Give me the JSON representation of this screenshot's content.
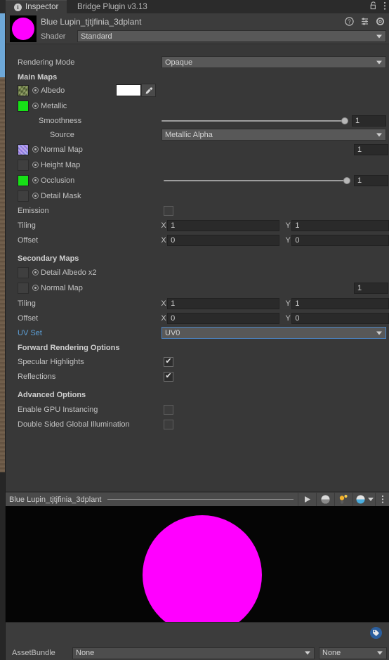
{
  "window": {
    "tabs": [
      {
        "label": "Inspector",
        "icon": "info-icon",
        "active": true
      },
      {
        "label": "Bridge Plugin v3.13",
        "active": false
      }
    ],
    "lock_icon": "lock-open-icon",
    "menu_icon": "kebab-menu-icon"
  },
  "material": {
    "name": "Blue Lupin_tjtjfinia_3dplant",
    "preview_color": "#ff00ff",
    "header_icons": [
      "help-icon",
      "preset-icon",
      "gear-icon"
    ],
    "shader_label": "Shader",
    "shader_value": "Standard"
  },
  "properties": {
    "rendering_mode_label": "Rendering Mode",
    "rendering_mode_value": "Opaque",
    "main_maps_header": "Main Maps",
    "albedo_label": "Albedo",
    "albedo_color": "#ffffff",
    "metallic_label": "Metallic",
    "smoothness_label": "Smoothness",
    "smoothness_value": "1",
    "source_label": "Source",
    "source_value": "Metallic Alpha",
    "normal_map_label": "Normal Map",
    "normal_map_value": "1",
    "height_map_label": "Height Map",
    "occlusion_label": "Occlusion",
    "occlusion_value": "1",
    "detail_mask_label": "Detail Mask",
    "emission_label": "Emission",
    "emission_checked": false,
    "tiling_label": "Tiling",
    "tiling_x": "1",
    "tiling_y": "1",
    "offset_label": "Offset",
    "offset_x": "0",
    "offset_y": "0",
    "x_axis": "X",
    "y_axis": "Y"
  },
  "secondary": {
    "header": "Secondary Maps",
    "detail_albedo_label": "Detail Albedo x2",
    "normal_map_label": "Normal Map",
    "normal_map_value": "1",
    "tiling_label": "Tiling",
    "tiling_x": "1",
    "tiling_y": "1",
    "offset_label": "Offset",
    "offset_x": "0",
    "offset_y": "0",
    "uv_set_label": "UV Set",
    "uv_set_value": "UV0",
    "x_axis": "X",
    "y_axis": "Y"
  },
  "forward_rendering": {
    "header": "Forward Rendering Options",
    "specular_label": "Specular Highlights",
    "specular_checked": true,
    "reflections_label": "Reflections",
    "reflections_checked": true,
    "check_glyph": "✔"
  },
  "advanced": {
    "header": "Advanced Options",
    "gpu_instancing_label": "Enable GPU Instancing",
    "gpu_instancing_checked": false,
    "double_sided_label": "Double Sided Global Illumination",
    "double_sided_checked": false
  },
  "preview": {
    "title": "Blue Lupin_tjtjfinia_3dplant",
    "buttons": [
      "play-icon",
      "lighting-sphere-icon",
      "light-bulb-icon",
      "render-mode-sphere-icon",
      "kebab-menu-icon"
    ],
    "sphere_color": "#ff00ff",
    "background": "#050505"
  },
  "footer": {
    "tag_icon": "tag-icon",
    "assetbundle_label": "AssetBundle",
    "assetbundle_value": "None",
    "variant_value": "None"
  }
}
